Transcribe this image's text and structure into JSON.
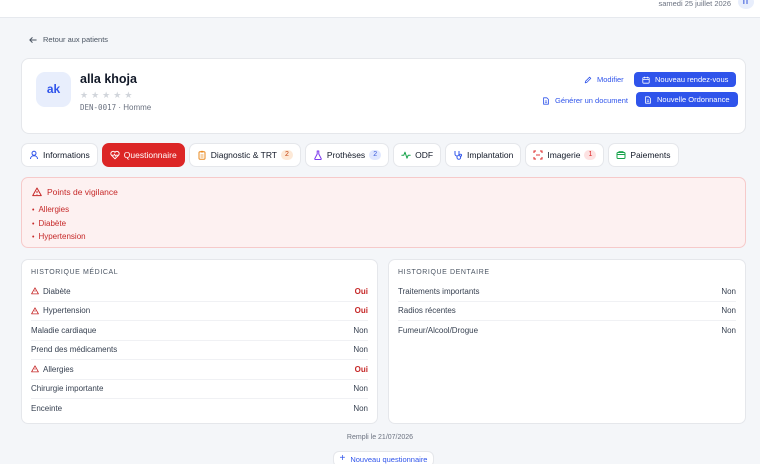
{
  "topbar": {
    "date": "samedi 25 juillet 2026",
    "user_initials": "IT"
  },
  "back_label": "Retour aux patients",
  "patient": {
    "initials": "ak",
    "name": "alla khoja",
    "rating": 0,
    "code": "DEN-0017",
    "gender": "Homme"
  },
  "actions": {
    "edit": "Modifier",
    "generate_doc": "Générer un document",
    "new_appointment": "Nouveau rendez-vous",
    "new_prescription": "Nouvelle Ordonnance"
  },
  "tabs": [
    {
      "label": "Informations",
      "icon": "user-icon",
      "active": false
    },
    {
      "label": "Questionnaire",
      "icon": "heart-pulse-icon",
      "active": true
    },
    {
      "label": "Diagnostic & TRT",
      "icon": "clipboard-icon",
      "badge": "2",
      "active": false
    },
    {
      "label": "Prothèses",
      "icon": "flask-icon",
      "badge": "2",
      "active": false
    },
    {
      "label": "ODF",
      "icon": "activity-icon",
      "active": false
    },
    {
      "label": "Implantation",
      "icon": "stethoscope-icon",
      "active": false
    },
    {
      "label": "Imagerie",
      "icon": "scan-icon",
      "badge": "1",
      "active": false
    },
    {
      "label": "Paiements",
      "icon": "wallet-icon",
      "active": false
    }
  ],
  "alert": {
    "title": "Points de vigilance",
    "items": [
      "Allergies",
      "Diabète",
      "Hypertension"
    ]
  },
  "medical_history": {
    "title": "HISTORIQUE MÉDICAL",
    "rows": [
      {
        "label": "Diabète",
        "value": "Oui",
        "warn": true
      },
      {
        "label": "Hypertension",
        "value": "Oui",
        "warn": true
      },
      {
        "label": "Maladie cardiaque",
        "value": "Non",
        "warn": false
      },
      {
        "label": "Prend des médicaments",
        "value": "Non",
        "warn": false
      },
      {
        "label": "Allergies",
        "value": "Oui",
        "warn": true
      },
      {
        "label": "Chirurgie importante",
        "value": "Non",
        "warn": false
      },
      {
        "label": "Enceinte",
        "value": "Non",
        "warn": false
      }
    ]
  },
  "dental_history": {
    "title": "HISTORIQUE DENTAIRE",
    "rows": [
      {
        "label": "Traitements importants",
        "value": "Non"
      },
      {
        "label": "Radios récentes",
        "value": "Non"
      },
      {
        "label": "Fumeur/Alcool/Drogue",
        "value": "Non"
      }
    ]
  },
  "footer": {
    "filled_label": "Rempli le 21/07/2026",
    "new_questionnaire": "Nouveau questionnaire"
  },
  "colors": {
    "accent": "#2f54eb",
    "danger": "#dc2626"
  }
}
